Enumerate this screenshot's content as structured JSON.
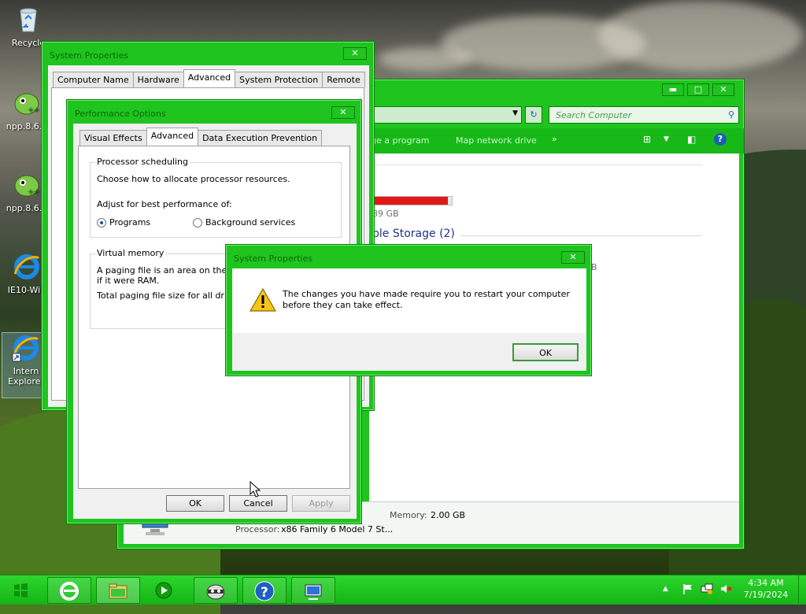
{
  "desktop": {
    "icons": [
      {
        "label": "Recycle",
        "icon": "recycle-bin-icon"
      },
      {
        "label": "npp.8.6.7",
        "icon": "notepad-plus-plus-icon"
      },
      {
        "label": "npp.8.6.9",
        "icon": "notepad-plus-plus-icon"
      },
      {
        "label": "IE10-Win",
        "icon": "internet-explorer-icon"
      },
      {
        "label": "Internet Explorer",
        "label_line1": "Intern",
        "label_line2": "Explorer",
        "icon": "internet-explorer-shortcut-icon"
      }
    ]
  },
  "computer_window": {
    "search_placeholder": "Search Computer",
    "toolbar": {
      "uninstall_label": "ge a program",
      "map_drive_label": "Map network drive",
      "more_label": "»"
    },
    "storage_size": "89 GB",
    "storage_fill_percent": 95,
    "storage_color": "#e11818",
    "removable_header": "ble Storage (2)",
    "b_suffix": "B",
    "memory_label": "Memory:",
    "memory_value": "2.00 GB",
    "processor_label": "Processor:",
    "processor_value": "x86 Family 6 Model 7 St..."
  },
  "system_properties_window": {
    "title": "System Properties",
    "tabs": [
      "Computer Name",
      "Hardware",
      "Advanced",
      "System Protection",
      "Remote"
    ],
    "active_tab": "Advanced"
  },
  "performance_window": {
    "title": "Performance Options",
    "tabs": [
      "Visual Effects",
      "Advanced",
      "Data Execution Prevention"
    ],
    "active_tab": "Advanced",
    "processor_group": {
      "title": "Processor scheduling",
      "description": "Choose how to allocate processor resources.",
      "adjust_label": "Adjust for best performance of:",
      "options": [
        {
          "label": "Programs",
          "selected": true
        },
        {
          "label": "Background services",
          "selected": false
        }
      ]
    },
    "virtual_memory_group": {
      "title": "Virtual memory",
      "desc_line1": "A paging file is an area on the har",
      "desc_line2": "if it were RAM.",
      "total_label": "Total paging file size for all drives:"
    },
    "buttons": {
      "ok": "OK",
      "cancel": "Cancel",
      "apply": "Apply"
    }
  },
  "dialog": {
    "title": "System Properties",
    "message_line1": "The changes you have made require you to restart your computer",
    "message_line2": "before they can take effect.",
    "ok_label": "OK"
  },
  "taskbar": {
    "time": "4:34 AM",
    "date": "7/19/2024",
    "accent": "#1fc41f"
  }
}
